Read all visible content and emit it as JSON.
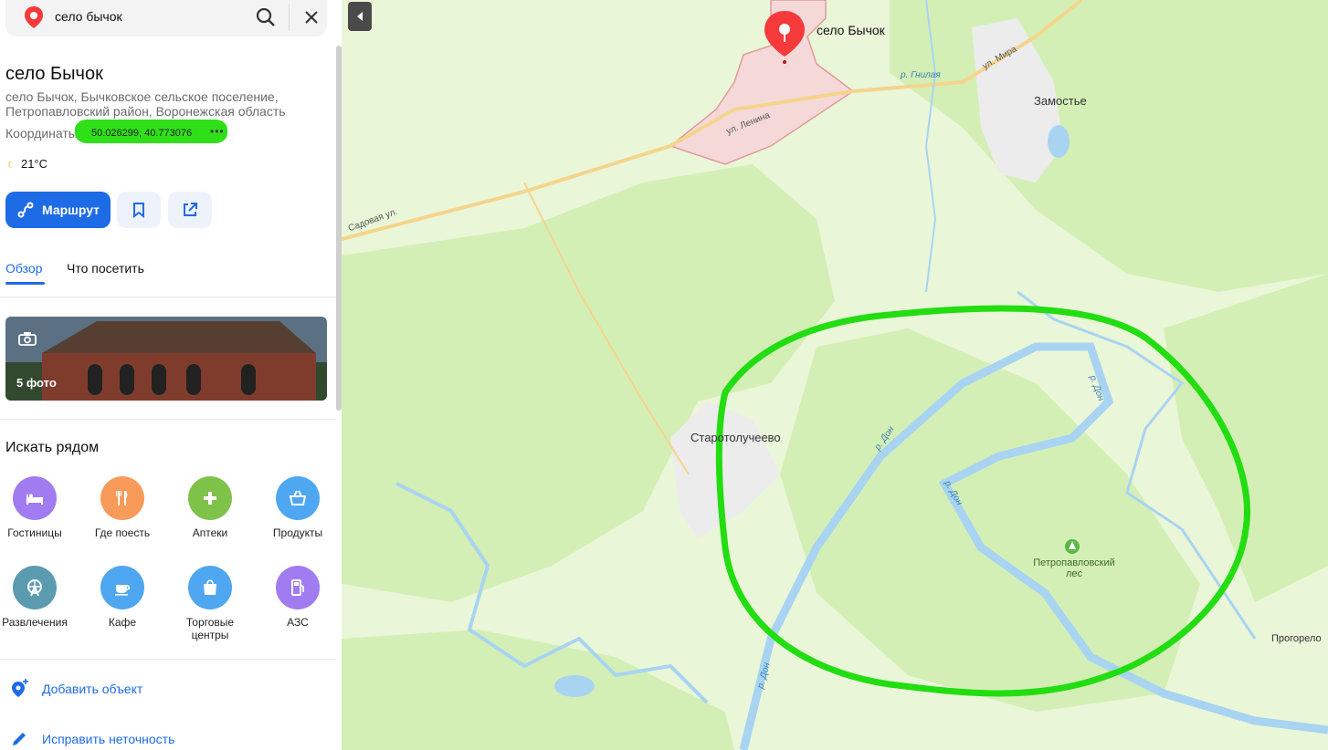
{
  "search": {
    "query": "село бычок"
  },
  "place": {
    "title": "село Бычок",
    "address_line1": "село Бычок, Бычковское сельское поселение,",
    "address_line2": "Петропавловский район, Воронежская область",
    "coords_label": "Координаты:",
    "coords_value": "50.026299, 40.773076",
    "coords_more": "•••",
    "weather": "21°C"
  },
  "actions": {
    "route_label": "Маршрут"
  },
  "tabs": [
    {
      "label": "Обзор"
    },
    {
      "label": "Что посетить"
    }
  ],
  "photos": {
    "label": "5 фото"
  },
  "nearby": {
    "title": "Искать рядом",
    "items": [
      {
        "label": "Гостиницы",
        "color": "#a07cf0",
        "icon": "bed-icon"
      },
      {
        "label": "Где поесть",
        "color": "#f79a5a",
        "icon": "fork-knife-icon"
      },
      {
        "label": "Аптеки",
        "color": "#7fc24a",
        "icon": "pharmacy-cross-icon"
      },
      {
        "label": "Продукты",
        "color": "#4ea7f0",
        "icon": "basket-icon"
      },
      {
        "label": "Развлечения",
        "color": "#5a9bb0",
        "icon": "ferris-wheel-icon"
      },
      {
        "label": "Кафе",
        "color": "#4ea7f0",
        "icon": "coffee-cup-icon"
      },
      {
        "label": "Торговые центры",
        "color": "#4ea7f0",
        "icon": "shopping-bag-icon"
      },
      {
        "label": "АЗС",
        "color": "#a07cf0",
        "icon": "fuel-icon"
      }
    ]
  },
  "footer_actions": [
    {
      "label": "Добавить объект"
    },
    {
      "label": "Исправить неточность"
    }
  ],
  "map": {
    "pin_label": "село Бычок",
    "places": {
      "zamostye": "Замостье",
      "starotoluchevo": "Старотолучеево",
      "forest_line1": "Петропавловский",
      "forest_line2": "лес",
      "progorelo": "Прогорело"
    },
    "streets": {
      "lenina": "ул. Ленина",
      "mira": "ул. Мира",
      "sadovaya": "Садовая ул."
    },
    "rivers": {
      "gnilaya": "р. Гнилая",
      "don": "р. Дон"
    },
    "colors": {
      "water": "#a8d4f2",
      "forest": "#d4efb6",
      "highlight_circle": "#22dd11",
      "settlement": "#f5d9d9"
    }
  }
}
